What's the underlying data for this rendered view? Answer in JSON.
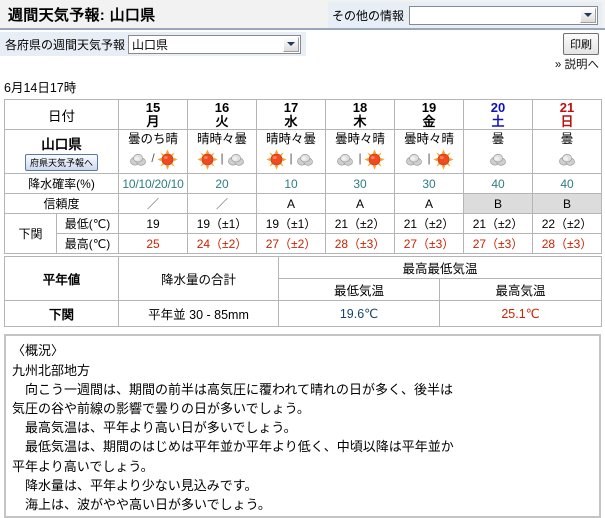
{
  "header": {
    "title": "週間天気予報: 山口県",
    "other_info_label": "その他の情報",
    "other_info_value": "",
    "pref_select_label": "各府県の週間天気予報",
    "pref_select_value": "山口県",
    "print_button": "印刷",
    "explain_link": "» 説明へ"
  },
  "timestamp": "6月14日17時",
  "table": {
    "labels": {
      "date": "日付",
      "region": "山口県",
      "region_button": "府県天気予報へ",
      "pop": "降水確率(%)",
      "reliability": "信頼度",
      "station": "下関",
      "tmin": "最低(℃)",
      "tmax": "最高(℃)"
    },
    "days": [
      {
        "num": "15",
        "dow": "月",
        "kind": "weekday"
      },
      {
        "num": "16",
        "dow": "火",
        "kind": "weekday"
      },
      {
        "num": "17",
        "dow": "水",
        "kind": "weekday"
      },
      {
        "num": "18",
        "dow": "木",
        "kind": "weekday"
      },
      {
        "num": "19",
        "dow": "金",
        "kind": "weekday"
      },
      {
        "num": "20",
        "dow": "土",
        "kind": "sat"
      },
      {
        "num": "21",
        "dow": "日",
        "kind": "sun"
      }
    ],
    "weather": [
      {
        "text": "曇のち晴",
        "icons": [
          "cloud",
          "sun"
        ],
        "sep": "/"
      },
      {
        "text": "晴時々曇",
        "icons": [
          "sun",
          "cloud"
        ],
        "sep": "|"
      },
      {
        "text": "晴時々曇",
        "icons": [
          "sun",
          "cloud"
        ],
        "sep": "|"
      },
      {
        "text": "曇時々晴",
        "icons": [
          "cloud",
          "sun"
        ],
        "sep": "|"
      },
      {
        "text": "曇時々晴",
        "icons": [
          "cloud",
          "sun"
        ],
        "sep": "|"
      },
      {
        "text": "曇",
        "icons": [
          "cloud"
        ],
        "sep": ""
      },
      {
        "text": "曇",
        "icons": [
          "cloud"
        ],
        "sep": ""
      }
    ],
    "pop": [
      "10/10/20/10",
      "20",
      "10",
      "30",
      "30",
      "40",
      "40"
    ],
    "reliability": [
      "／",
      "／",
      "A",
      "A",
      "A",
      "B",
      "B"
    ],
    "tmin": [
      "19",
      "19（±1）",
      "19（±1）",
      "21（±2）",
      "21（±2）",
      "21（±2）",
      "22（±2）"
    ],
    "tmax": [
      "25",
      "24（±2）",
      "27（±2）",
      "28（±3）",
      "27（±3）",
      "27（±3）",
      "28（±3）"
    ]
  },
  "normals": {
    "title": "平年値",
    "precip_header": "降水量の合計",
    "temp_header": "最高最低気温",
    "tmin_header": "最低気温",
    "tmax_header": "最高気温",
    "station": "下関",
    "precip_value": "平年並 30 - 85mm",
    "tmin_value": "19.6℃",
    "tmax_value": "25.1℃"
  },
  "outlook": {
    "text": "〈概況〉\n九州北部地方\n　向こう一週間は、期間の前半は高気圧に覆われて晴れの日が多く、後半は\n気圧の谷や前線の影響で曇りの日が多いでしょう。\n　最高気温は、平年より高い日が多いでしょう。\n　最低気温は、期間のはじめは平年並か平年より低く、中頃以降は平年並か\n平年より高いでしょう。\n　降水量は、平年より少ない見込みです。\n　海上は、波がやや高い日が多いでしょう。"
  },
  "colors": {
    "accent": "#e8eef5",
    "pop_text": "#2e7d82",
    "tmax_text": "#cc2200",
    "saturday": "#1111bb",
    "sunday": "#bb1111"
  }
}
